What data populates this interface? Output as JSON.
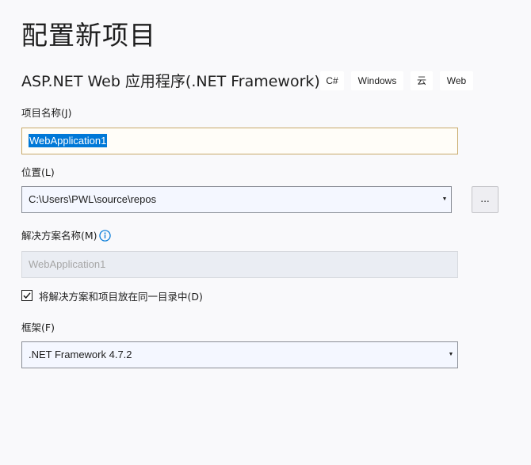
{
  "page_title": "配置新项目",
  "template": {
    "name": "ASP.NET Web 应用程序(.NET Framework)",
    "tags": [
      "C#",
      "Windows",
      "云",
      "Web"
    ]
  },
  "project_name": {
    "label": "项目名称(J)",
    "value": "WebApplication1"
  },
  "location": {
    "label": "位置(L)",
    "value": "C:\\Users\\PWL\\source\\repos",
    "browse_label": "..."
  },
  "solution_name": {
    "label": "解决方案名称(M)",
    "value": "WebApplication1"
  },
  "same_directory": {
    "label": "将解决方案和项目放在同一目录中(D)",
    "checked": true
  },
  "framework": {
    "label": "框架(F)",
    "value": ".NET Framework 4.7.2"
  },
  "colors": {
    "accent": "#0078d7",
    "background": "#f9f9fb"
  },
  "icons": {
    "info": "info-icon",
    "check": "check-icon",
    "dropdown": "chevron-down-icon"
  }
}
